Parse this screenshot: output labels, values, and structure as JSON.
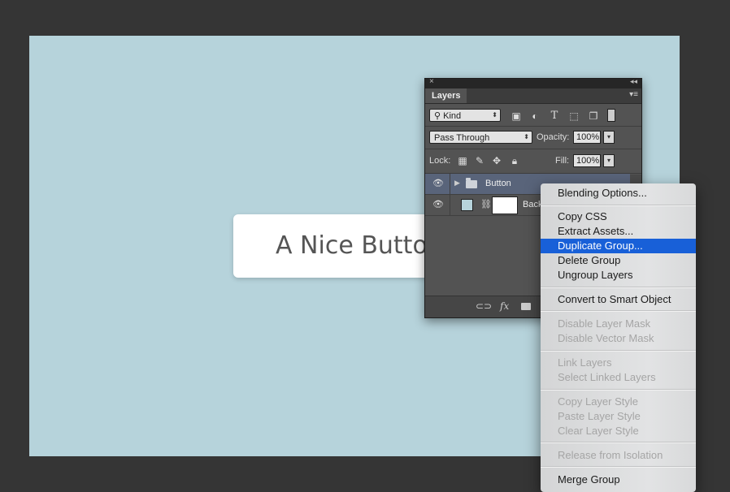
{
  "canvas": {
    "background": "#b6d3db",
    "button_text": "A Nice Button"
  },
  "layers_panel": {
    "close_glyph": "×",
    "collapse_glyph": "◂◂",
    "tab_label": "Layers",
    "menu_glyph": "▾≡",
    "filter": {
      "search_glyph": "⚲",
      "kind_value": "Kind"
    },
    "blend_mode_value": "Pass Through",
    "opacity_label": "Opacity:",
    "opacity_value": "100%",
    "lock_label": "Lock:",
    "fill_label": "Fill:",
    "fill_value": "100%",
    "layers": [
      {
        "name": "Button",
        "type": "group"
      },
      {
        "name": "Background",
        "type": "layer"
      }
    ],
    "footer_fx": "fx"
  },
  "context_menu": {
    "accent": "#1860d8",
    "items": [
      {
        "label": "Blending Options...",
        "enabled": true
      },
      {
        "label": "Copy CSS",
        "enabled": true
      },
      {
        "label": "Extract Assets...",
        "enabled": true
      },
      {
        "label": "Duplicate Group...",
        "enabled": true,
        "highlighted": true
      },
      {
        "label": "Delete Group",
        "enabled": true
      },
      {
        "label": "Ungroup Layers",
        "enabled": true
      },
      {
        "label": "Convert to Smart Object",
        "enabled": true
      },
      {
        "label": "Disable Layer Mask",
        "enabled": false
      },
      {
        "label": "Disable Vector Mask",
        "enabled": false
      },
      {
        "label": "Link Layers",
        "enabled": false
      },
      {
        "label": "Select Linked Layers",
        "enabled": false
      },
      {
        "label": "Copy Layer Style",
        "enabled": false
      },
      {
        "label": "Paste Layer Style",
        "enabled": false
      },
      {
        "label": "Clear Layer Style",
        "enabled": false
      },
      {
        "label": "Release from Isolation",
        "enabled": false
      },
      {
        "label": "Merge Group",
        "enabled": true
      }
    ]
  }
}
